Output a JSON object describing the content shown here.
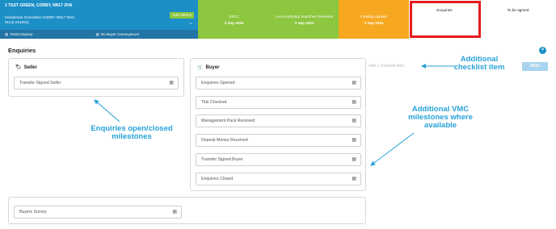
{
  "property": {
    "address": "1 TEST GREEN, CORBY, NN17 2HA",
    "client": "Henderson Gonnalton CORBY NN17 5NU",
    "ref": "0114(-231831)",
    "add_client_label": "Add client",
    "company": "TestCompany",
    "buyer_company": "No Buyer Conveyancer"
  },
  "stages": [
    {
      "label": "SSTC",
      "date": "4 Sep 2024",
      "status": "complete"
    },
    {
      "label": "Local Authority Searches Delivered",
      "date": "3 Sep 2024",
      "status": "complete"
    },
    {
      "label": "Funding Applied",
      "date": "3 Sep 2024",
      "status": "in-progress"
    },
    {
      "label": "Enquiries",
      "date": "",
      "status": "current"
    },
    {
      "label": "To be agreed",
      "date": "",
      "status": "pending"
    }
  ],
  "page": {
    "title": "Enquiries",
    "checklist_placeholder": "Add a checklist item",
    "add_label": "ADD"
  },
  "seller": {
    "title": "Seller",
    "milestones": [
      "Transfer Signed Seller"
    ]
  },
  "buyer": {
    "title": "Buyer",
    "milestones": [
      "Enquiries Opened",
      "Title Checked",
      "Management Pack Received",
      "Deposit Money Received",
      "Transfer Signed Buyer",
      "Enquiries Closed"
    ]
  },
  "extra": {
    "milestones": [
      "Buyers Survey"
    ]
  },
  "annotations": {
    "checklist": [
      "Additional",
      "checklist item"
    ],
    "vmc": [
      "Additional VMC",
      "milestones where",
      "available"
    ],
    "enquiries": [
      "Enquiries open/closed",
      "milestones"
    ]
  },
  "colors": {
    "primary": "#1c8fc7",
    "complete": "#8dc63f",
    "in_progress": "#f6a821",
    "highlight": "#e41b1b",
    "annotation": "#27a2d9"
  },
  "icons": {
    "seller": "tag-icon",
    "buyer": "cart-icon",
    "date": "calendar-icon",
    "close": "close-icon"
  }
}
